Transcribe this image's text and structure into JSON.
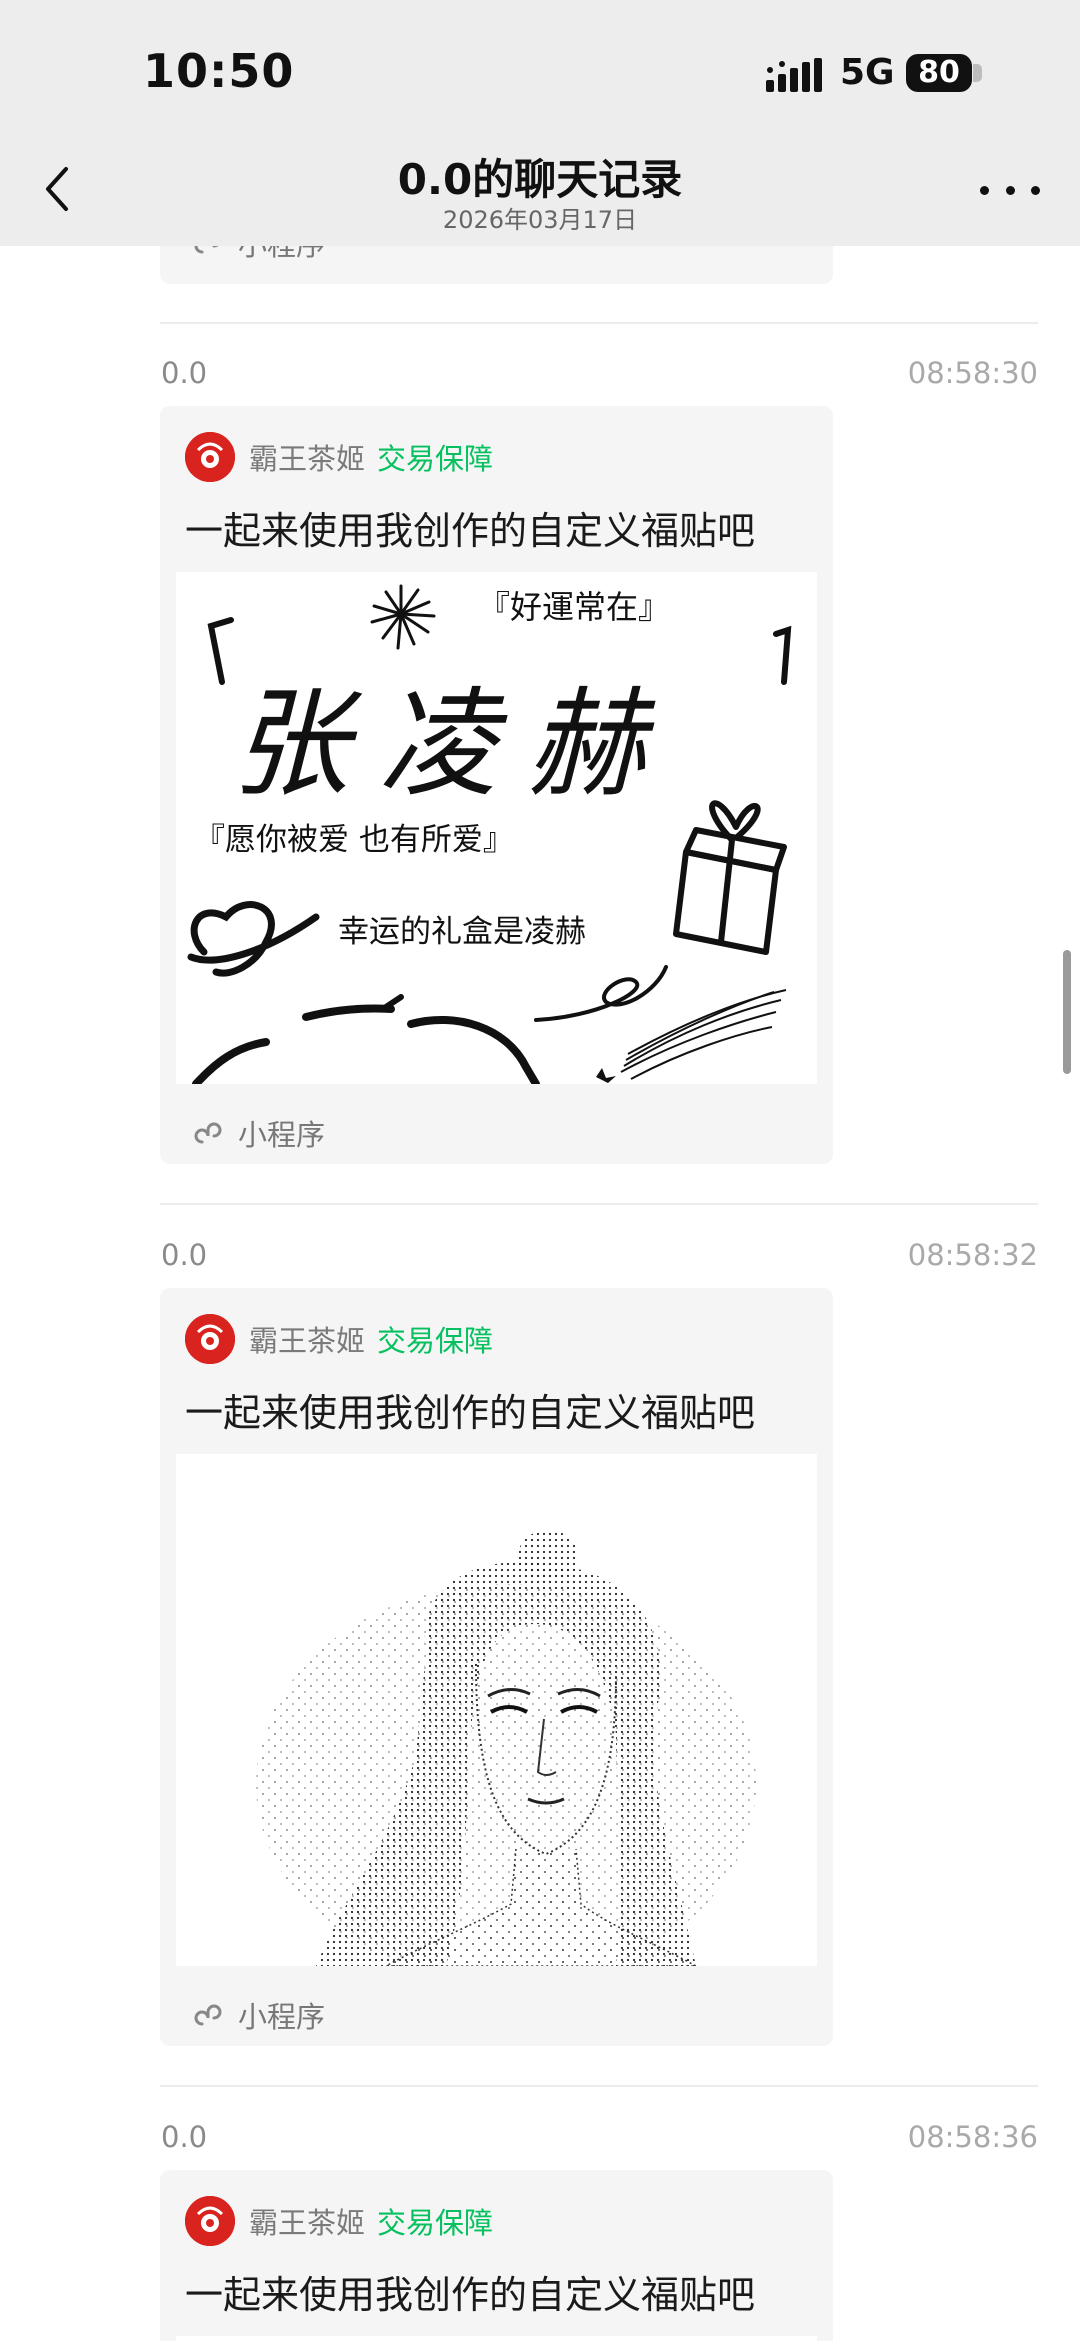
{
  "status_bar": {
    "time": "10:50",
    "network": "5G",
    "battery": "80"
  },
  "nav": {
    "title": "0.0的聊天记录",
    "subtitle": "2026年03月17日"
  },
  "prev_card": {
    "footer_label": "小程序"
  },
  "messages": [
    {
      "sender": "0.0",
      "time": "08:58:30",
      "app_name": "霸王茶姬",
      "guarantee": "交易保障",
      "title": "一起来使用我创作的自定义福贴吧",
      "footer_label": "小程序",
      "poster": {
        "blessing_top": "『好運常在』",
        "name": "张凌赫",
        "wish": "『愿你被爱 也有所爱』",
        "gift_line": "幸运的礼盒是凌赫"
      }
    },
    {
      "sender": "0.0",
      "time": "08:58:32",
      "app_name": "霸王茶姬",
      "guarantee": "交易保障",
      "title": "一起来使用我创作的自定义福贴吧",
      "footer_label": "小程序"
    },
    {
      "sender": "0.0",
      "time": "08:58:36",
      "app_name": "霸王茶姬",
      "guarantee": "交易保障",
      "title": "一起来使用我创作的自定义福贴吧"
    }
  ]
}
